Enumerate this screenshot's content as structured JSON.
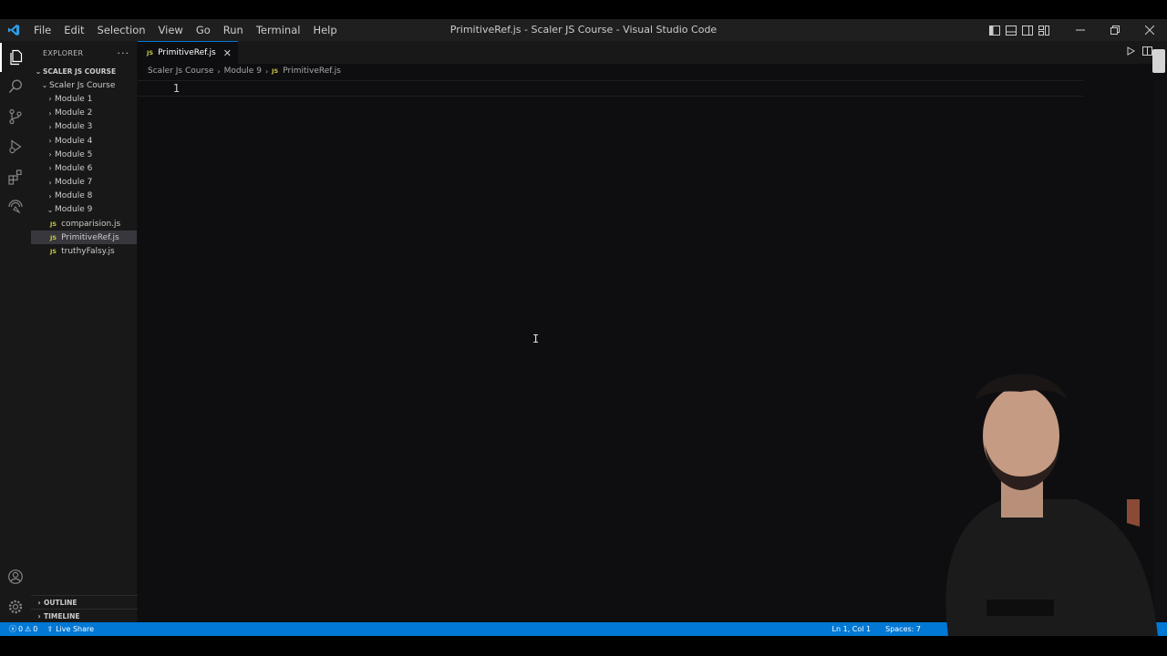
{
  "menu": [
    "File",
    "Edit",
    "Selection",
    "View",
    "Go",
    "Run",
    "Terminal",
    "Help"
  ],
  "window_title": "PrimitiveRef.js - Scaler JS Course - Visual Studio Code",
  "explorer": {
    "header": "EXPLORER",
    "more": "···",
    "workspace": "SCALER JS COURSE",
    "root_folder": "Scaler Js Course",
    "modules": [
      "Module 1",
      "Module 2",
      "Module 3",
      "Module 4",
      "Module 5",
      "Module 6",
      "Module 7",
      "Module 8"
    ],
    "open_module": "Module 9",
    "files": [
      "comparision.js",
      "PrimitiveRef.js",
      "truthyFalsy.js"
    ],
    "selected_file": "PrimitiveRef.js",
    "outline": "OUTLINE",
    "timeline": "TIMELINE"
  },
  "tab": {
    "label": "PrimitiveRef.js",
    "icon": "JS",
    "close": "✕"
  },
  "breadcrumb": [
    "Scaler Js Course",
    "Module 9",
    "PrimitiveRef.js"
  ],
  "editor": {
    "line_number": "1"
  },
  "status": {
    "errors": "0",
    "warnings": "0",
    "live_share": "Live Share",
    "position": "Ln 1, Col 1",
    "spaces": "Spaces: 7"
  },
  "colors": {
    "status_bar": "#0078d4",
    "accent": "#0078d4",
    "js_badge": "#cbcb41"
  }
}
